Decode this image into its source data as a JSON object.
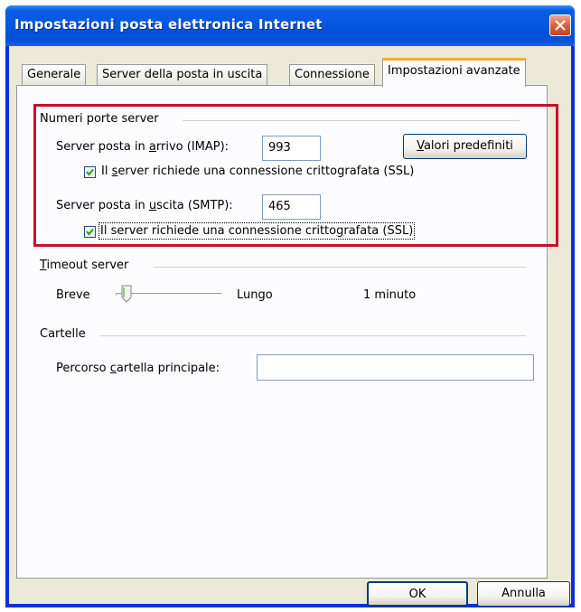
{
  "window": {
    "title": "Impostazioni posta elettronica Internet"
  },
  "tabs": [
    {
      "label": "Generale",
      "active": false
    },
    {
      "label": "Server della posta in uscita",
      "active": false
    },
    {
      "label": "Connessione",
      "active": false
    },
    {
      "label": "Impostazioni avanzate",
      "active": true
    }
  ],
  "ports": {
    "group_label": "Numeri porte server",
    "incoming": {
      "label_pre": "Server posta in ",
      "label_acc": "a",
      "label_post": "rrivo (IMAP):",
      "value": "993"
    },
    "incoming_ssl": {
      "checked": true,
      "label_pre": "Il ",
      "label_acc": "s",
      "label_post": "erver richiede una connessione crittografata (SSL)"
    },
    "outgoing": {
      "label_pre": "Server posta in ",
      "label_acc": "u",
      "label_post": "scita (SMTP):",
      "value": "465"
    },
    "outgoing_ssl": {
      "checked": true,
      "label_pre": "Il server richiede una connessione critto",
      "label_acc": "g",
      "label_post": "rafata (SSL)"
    },
    "defaults_button": {
      "label_acc": "V",
      "label_post": "alori predefiniti"
    }
  },
  "timeout": {
    "group_label_acc": "T",
    "group_label_post": "imeout server",
    "short_label": "Breve",
    "long_label": "Lungo",
    "value_text": "1 minuto",
    "level": 0.1
  },
  "folders": {
    "group_label": "Cartelle",
    "root_path_pre": "Percorso ",
    "root_path_acc": "c",
    "root_path_post": "artella principale:",
    "root_path_value": ""
  },
  "buttons": {
    "ok": "OK",
    "cancel": "Annulla"
  },
  "colors": {
    "highlight_border": "#c8102e",
    "active_tab_accent": "#fcaa31",
    "titlebar": "#0558e0"
  }
}
